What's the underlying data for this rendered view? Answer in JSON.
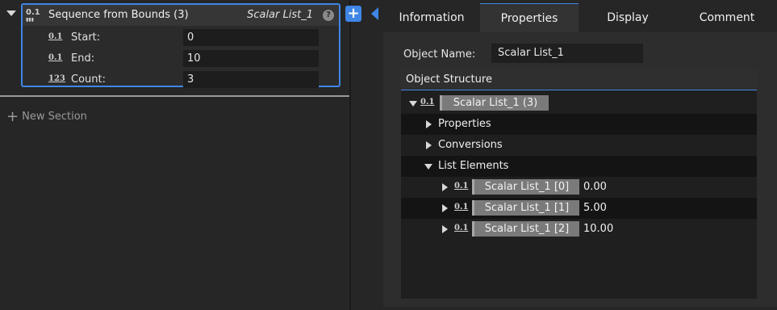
{
  "node": {
    "title": "Sequence from Bounds (3)",
    "output_name": "Scalar List_1",
    "help": "?",
    "params": [
      {
        "icon": "0.1",
        "label": "Start:",
        "value": "0"
      },
      {
        "icon": "0.1",
        "label": "End:",
        "value": "10"
      },
      {
        "icon": "123",
        "label": "Count:",
        "value": "3"
      }
    ]
  },
  "left_panel": {
    "new_section": "New Section"
  },
  "add_button": "+",
  "tabs": [
    "Information",
    "Properties",
    "Display",
    "Comment"
  ],
  "active_tab": "Properties",
  "properties": {
    "object_name_label": "Object Name:",
    "object_name_value": "Scalar List_1",
    "structure_header": "Object Structure",
    "root": "Scalar List_1 (3)",
    "groups": [
      "Properties",
      "Conversions",
      "List Elements"
    ],
    "elements": [
      {
        "name": "Scalar List_1 [0]",
        "value": "0.00"
      },
      {
        "name": "Scalar List_1 [1]",
        "value": "5.00"
      },
      {
        "name": "Scalar List_1 [2]",
        "value": "10.00"
      }
    ]
  },
  "colors": {
    "accent": "#3f86e6",
    "background": "#262626",
    "chip": "#7a7a7a"
  },
  "icons": [
    "collapse-triangle-icon",
    "scalar-list-icon",
    "help-icon",
    "plus-icon",
    "expand-arrow-icon"
  ]
}
